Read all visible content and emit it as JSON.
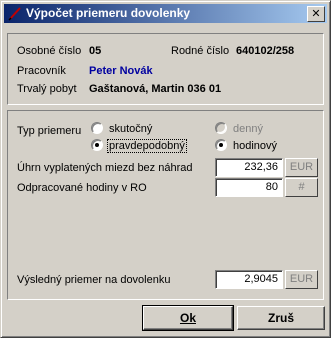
{
  "window": {
    "title": "Výpočet priemeru dovolenky",
    "icon": "pencil-icon"
  },
  "employee": {
    "id_label": "Osobné číslo",
    "id_value": "05",
    "birth_label": "Rodné číslo",
    "birth_value": "640102/258",
    "worker_label": "Pracovník",
    "worker_value": "Peter Novák",
    "address_label": "Trvalý pobyt",
    "address_value": "Gaštanová, Martin 036 01"
  },
  "average_type": {
    "label": "Typ priemeru",
    "options": [
      {
        "label": "skutočný",
        "selected": false,
        "enabled": true
      },
      {
        "label": "denný",
        "selected": false,
        "enabled": false
      },
      {
        "label": "pravdepodobný",
        "selected": true,
        "enabled": true
      },
      {
        "label": "hodinový",
        "selected": true,
        "enabled": true
      }
    ]
  },
  "wages": {
    "label": "Úhrn vyplatených miezd bez náhrad",
    "value": "232,36",
    "unit_button": "EUR"
  },
  "hours": {
    "label": "Odpracované hodiny v RO",
    "value": "80",
    "unit_button": "#"
  },
  "result": {
    "label": "Výsledný priemer na dovolenku",
    "value": "2,9045",
    "unit_button": "EUR"
  },
  "buttons": {
    "ok": "Ok",
    "cancel": "Zruš"
  },
  "colors": {
    "title_start": "#0a246a",
    "title_end": "#a6caf0",
    "worker_name": "#0000a0"
  }
}
